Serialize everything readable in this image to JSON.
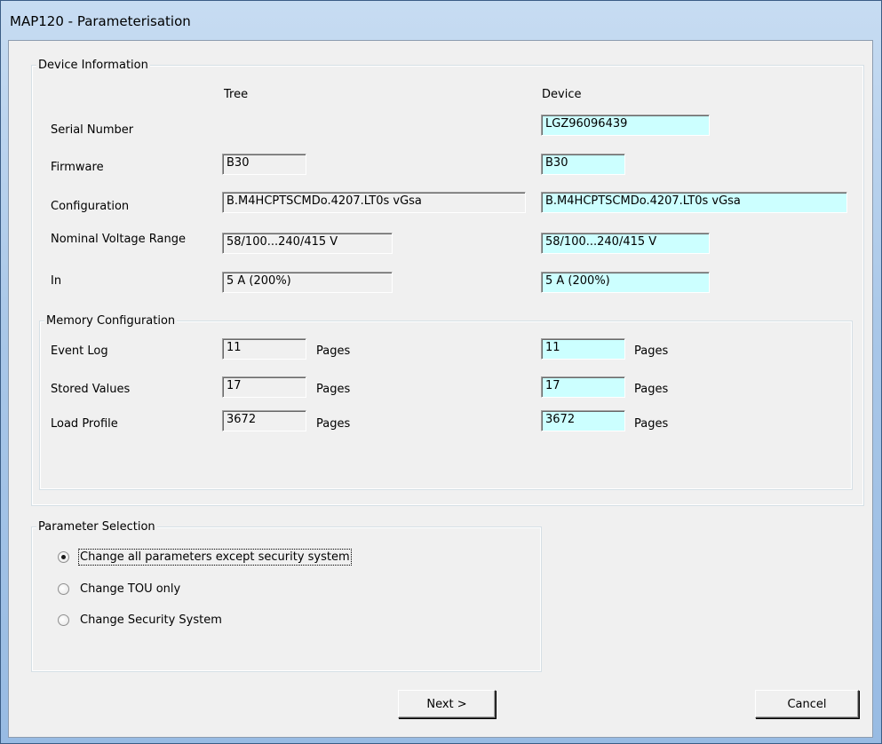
{
  "window": {
    "title": "MAP120 - Parameterisation"
  },
  "device_info": {
    "caption": "Device Information",
    "col_tree": "Tree",
    "col_device": "Device",
    "rows": [
      {
        "label": "Serial Number",
        "tree": "",
        "device": "LGZ96096439"
      },
      {
        "label": "Firmware",
        "tree": "B30",
        "device": "B30"
      },
      {
        "label": "Configuration",
        "tree": "B.M4HCPTSCMDo.4207.LT0s vGsa",
        "device": "B.M4HCPTSCMDo.4207.LT0s vGsa"
      },
      {
        "label": "Nominal Voltage Range",
        "tree": "58/100...240/415 V",
        "device": "58/100...240/415 V"
      },
      {
        "label": "In",
        "tree": "5 A (200%)",
        "device": "5 A (200%)"
      }
    ]
  },
  "memory": {
    "caption": "Memory Configuration",
    "unit": "Pages",
    "rows": [
      {
        "label": "Event Log",
        "tree": "11",
        "device": "11"
      },
      {
        "label": "Stored Values",
        "tree": "17",
        "device": "17"
      },
      {
        "label": "Load Profile",
        "tree": "3672",
        "device": "3672"
      }
    ]
  },
  "params": {
    "caption": "Parameter Selection",
    "options": [
      {
        "label": "Change all parameters except security system",
        "selected": true
      },
      {
        "label": "Change TOU only",
        "selected": false
      },
      {
        "label": "Change Security System",
        "selected": false
      }
    ]
  },
  "buttons": {
    "next": "Next >",
    "cancel": "Cancel"
  }
}
